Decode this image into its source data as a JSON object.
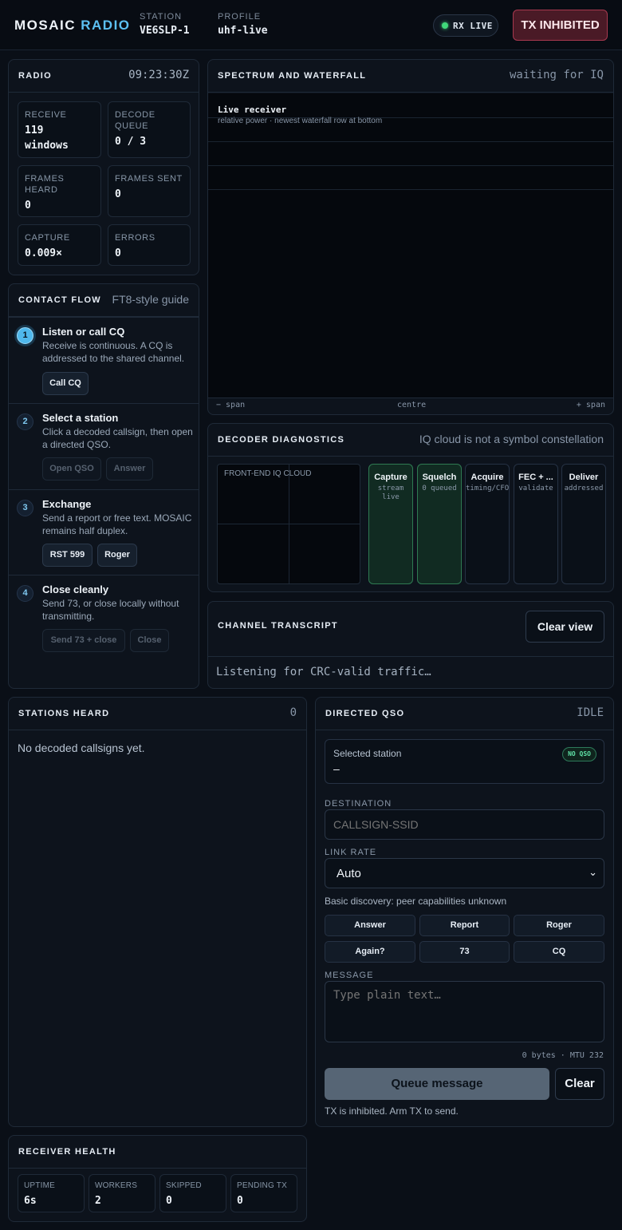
{
  "header": {
    "brand_main": "MOSAIC",
    "brand_accent": "RADIO",
    "station_label": "STATION",
    "station_value": "VE6SLP-1",
    "profile_label": "PROFILE",
    "profile_value": "uhf-live",
    "rx_status": "RX LIVE",
    "tx_button": "TX INHIBITED"
  },
  "radio": {
    "title": "RADIO",
    "time": "09:23:30Z",
    "stats": [
      {
        "label": "RECEIVE",
        "value": "119\nwindows"
      },
      {
        "label": "DECODE QUEUE",
        "value": "0 / 3"
      },
      {
        "label": "FRAMES HEARD",
        "value": "0"
      },
      {
        "label": "FRAMES SENT",
        "value": "0"
      },
      {
        "label": "CAPTURE",
        "value": "0.009×"
      },
      {
        "label": "ERRORS",
        "value": "0"
      }
    ]
  },
  "contact_flow": {
    "title": "CONTACT FLOW",
    "subtitle": "FT8-style guide",
    "steps": [
      {
        "num": "1",
        "title": "Listen or call CQ",
        "desc": "Receive is continuous. A CQ is addressed to the shared channel.",
        "buttons": [
          "Call CQ"
        ]
      },
      {
        "num": "2",
        "title": "Select a station",
        "desc": "Click a decoded callsign, then open a directed QSO.",
        "buttons": [
          "Open QSO",
          "Answer"
        ]
      },
      {
        "num": "3",
        "title": "Exchange",
        "desc": "Send a report or free text. MOSAIC remains half duplex.",
        "buttons": [
          "RST 599",
          "Roger"
        ]
      },
      {
        "num": "4",
        "title": "Close cleanly",
        "desc": "Send 73, or close locally without transmitting.",
        "buttons": [
          "Send 73 + close",
          "Close"
        ]
      }
    ]
  },
  "spectrum": {
    "title": "SPECTRUM AND WATERFALL",
    "status": "waiting for IQ",
    "overlay_title": "Live receiver",
    "overlay_sub": "relative power · newest waterfall row at bottom",
    "axis_left": "− span",
    "axis_center": "centre",
    "axis_right": "+ span"
  },
  "diagnostics": {
    "title": "DECODER DIAGNOSTICS",
    "note": "IQ cloud is not a symbol constellation",
    "iq_label": "FRONT-END IQ CLOUD",
    "pipeline": [
      {
        "name": "Capture",
        "sub": "stream live",
        "active": true
      },
      {
        "name": "Squelch",
        "sub": "0 queued",
        "active": true
      },
      {
        "name": "Acquire",
        "sub": "timing/CFO",
        "active": false
      },
      {
        "name": "FEC + ...",
        "sub": "validate",
        "active": false
      },
      {
        "name": "Deliver",
        "sub": "addressed",
        "active": false
      }
    ]
  },
  "transcript": {
    "title": "CHANNEL TRANSCRIPT",
    "clear_button": "Clear view",
    "listening": "Listening for CRC-valid traffic…"
  },
  "stations": {
    "title": "STATIONS HEARD",
    "count": "0",
    "empty": "No decoded callsigns yet."
  },
  "qso": {
    "title": "DIRECTED QSO",
    "state": "IDLE",
    "selected_label": "Selected station",
    "selected_value": "–",
    "badge": "NO QSO",
    "destination_label": "DESTINATION",
    "destination_placeholder": "CALLSIGN-SSID",
    "link_rate_label": "LINK RATE",
    "link_rate_value": "Auto",
    "discovery": "Basic discovery: peer capabilities unknown",
    "quick_buttons": [
      "Answer",
      "Report",
      "Roger",
      "Again?",
      "73",
      "CQ"
    ],
    "message_label": "MESSAGE",
    "message_placeholder": "Type plain text…",
    "byte_info": "0 bytes · MTU 232",
    "queue_button": "Queue message",
    "clear_button": "Clear",
    "tx_note": "TX is inhibited. Arm TX to send."
  },
  "health": {
    "title": "RECEIVER HEALTH",
    "stats": [
      {
        "label": "UPTIME",
        "value": "6s"
      },
      {
        "label": "WORKERS",
        "value": "2"
      },
      {
        "label": "SKIPPED",
        "value": "0"
      },
      {
        "label": "PENDING TX",
        "value": "0"
      }
    ]
  },
  "colors": {
    "accent": "#5cc0f2",
    "live": "#40d97a",
    "tx_inhibited": "#a8394f"
  }
}
